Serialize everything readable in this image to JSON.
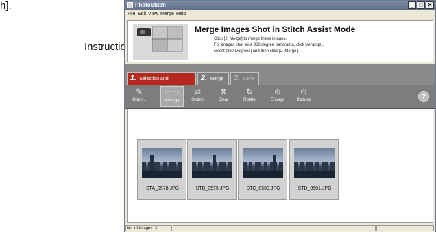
{
  "edge_text": "h].",
  "annotation": {
    "label": "Instructions"
  },
  "window": {
    "title": "PhotoStitch",
    "controls": {
      "minimize": "_",
      "maximize": "□",
      "close": "✕"
    }
  },
  "menu": [
    "File",
    "Edit",
    "View",
    "Merge",
    "Help"
  ],
  "banner": {
    "title": "Merge Images Shot in Stitch Assist Mode",
    "lines": [
      "Click [2. Merge] to merge these images.",
      "For images shot as a 360 degree panorama, click [Arrange],",
      "select [360 Degrees] and then click [2. Merge]."
    ]
  },
  "tabs": [
    {
      "num": "1.",
      "label": "Selection and Arrangement"
    },
    {
      "num": "2.",
      "label": "Merge"
    },
    {
      "num": "3.",
      "label": "Save"
    }
  ],
  "toolbar": [
    {
      "label": "Open...",
      "icon": "open-folder-icon"
    },
    {
      "label": "Arrange",
      "icon": "arrange-icon"
    },
    {
      "label": "Switch",
      "icon": "switch-icon"
    },
    {
      "label": "Clear",
      "icon": "clear-icon"
    },
    {
      "label": "Rotate",
      "icon": "rotate-icon"
    },
    {
      "label": "Enlarge",
      "icon": "zoom-in-icon"
    },
    {
      "label": "Reduce",
      "icon": "zoom-out-icon"
    }
  ],
  "help": {
    "icon": "help-icon",
    "glyph": "?"
  },
  "thumbnails": [
    {
      "name": "STA_0578.JPG"
    },
    {
      "name": "STB_0579.JPG"
    },
    {
      "name": "STC_0580.JPG"
    },
    {
      "name": "STD_0581.JPG"
    }
  ],
  "status": {
    "images_label": "No. of Images: 3"
  }
}
